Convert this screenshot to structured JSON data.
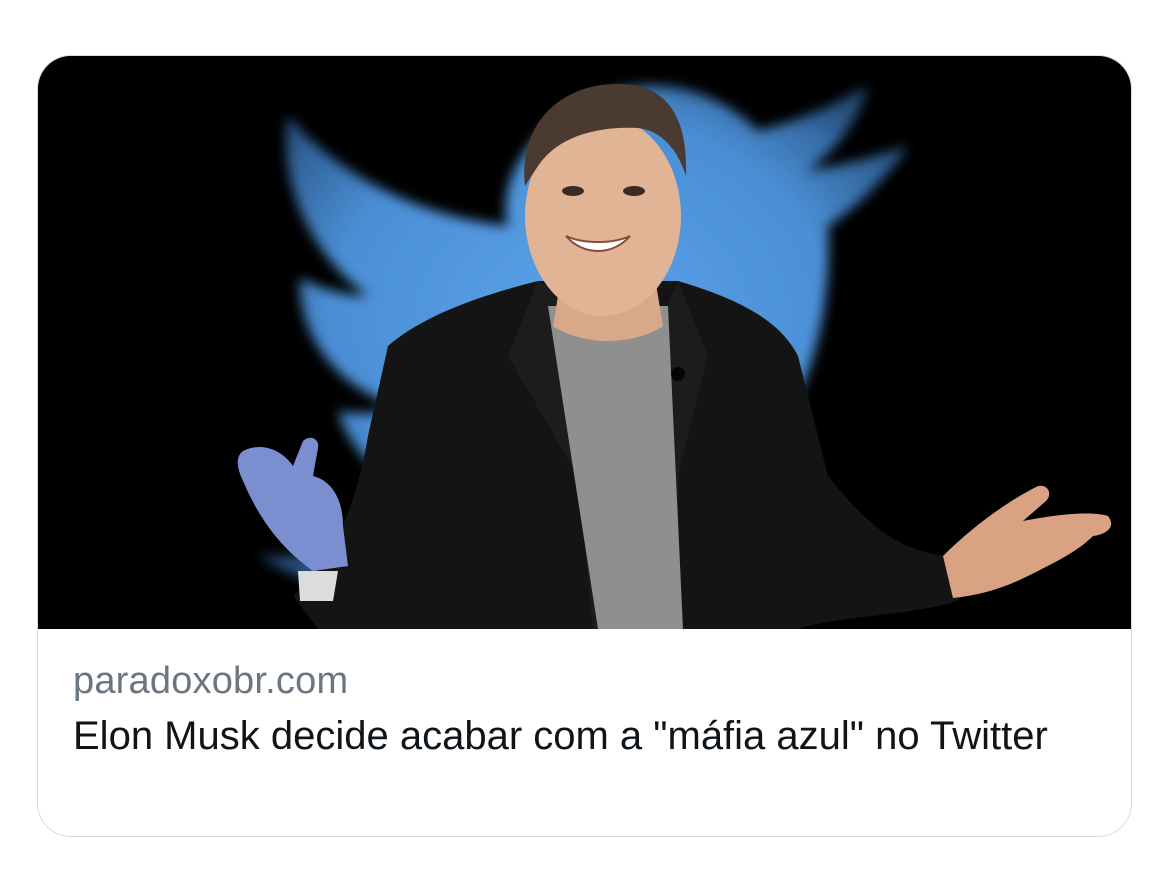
{
  "link_card": {
    "domain": "paradoxobr.com",
    "title": "Elon Musk decide acabar com a \"máfia azul\" no Twitter"
  },
  "media": {
    "background_color": "#000000",
    "logo_color": "#4b8fd6",
    "logo": "twitter-bird-logo",
    "subject": "man in dark blazer and grey t-shirt with open hands"
  },
  "colors": {
    "domain_text": "#6b7680",
    "title_text": "#0f1419",
    "card_border": "#d6dbe0"
  }
}
